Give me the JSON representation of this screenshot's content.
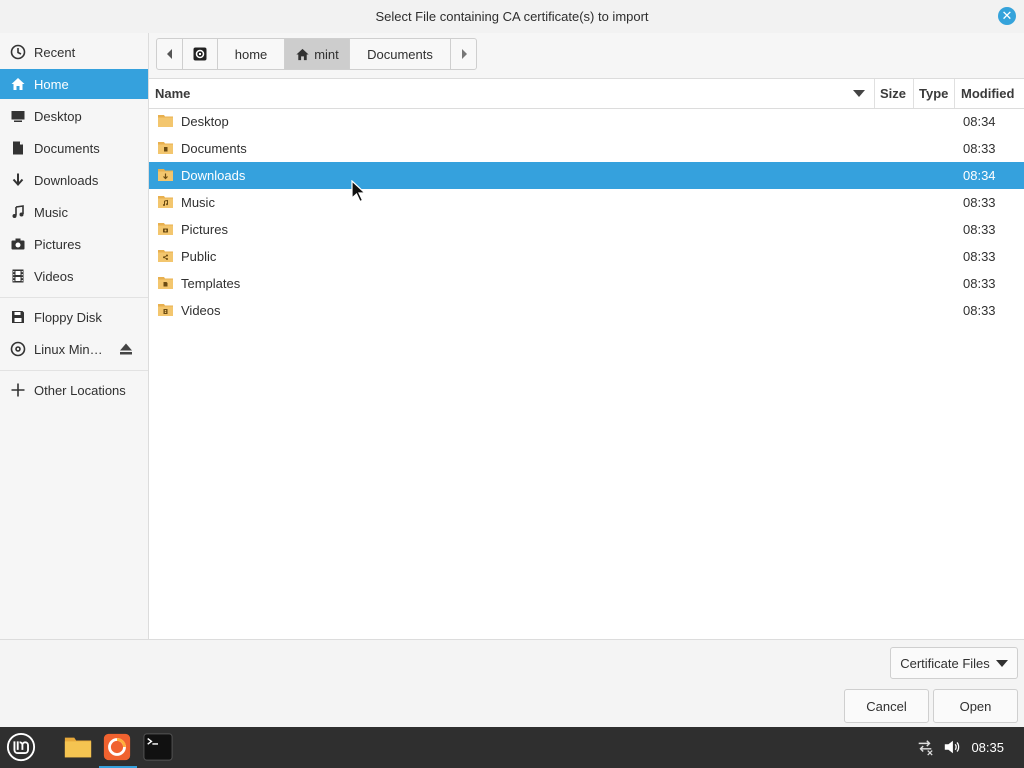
{
  "dialog": {
    "title": "Select File containing CA certificate(s) to import"
  },
  "sidebar": {
    "items": [
      {
        "label": "Recent",
        "icon": "clock-icon"
      },
      {
        "label": "Home",
        "icon": "home-icon"
      },
      {
        "label": "Desktop",
        "icon": "desktop-icon"
      },
      {
        "label": "Documents",
        "icon": "document-icon"
      },
      {
        "label": "Downloads",
        "icon": "download-icon"
      },
      {
        "label": "Music",
        "icon": "music-icon"
      },
      {
        "label": "Pictures",
        "icon": "camera-icon"
      },
      {
        "label": "Videos",
        "icon": "film-icon"
      },
      {
        "label": "Floppy Disk",
        "icon": "floppy-icon"
      },
      {
        "label": "Linux Min…",
        "icon": "disc-icon"
      },
      {
        "label": "Other Locations",
        "icon": "plus-icon"
      }
    ],
    "active": "Home"
  },
  "pathbar": {
    "crumbs": [
      "home",
      "mint",
      "Documents"
    ],
    "active": "mint"
  },
  "filelist": {
    "columns": [
      "Name",
      "Size",
      "Type",
      "Modified"
    ],
    "rows": [
      {
        "name": "Desktop",
        "modified": "08:34"
      },
      {
        "name": "Documents",
        "modified": "08:33"
      },
      {
        "name": "Downloads",
        "modified": "08:34"
      },
      {
        "name": "Music",
        "modified": "08:33"
      },
      {
        "name": "Pictures",
        "modified": "08:33"
      },
      {
        "name": "Public",
        "modified": "08:33"
      },
      {
        "name": "Templates",
        "modified": "08:33"
      },
      {
        "name": "Videos",
        "modified": "08:33"
      }
    ],
    "selected": "Downloads"
  },
  "footer": {
    "filter_label": "Certificate Files",
    "cancel_label": "Cancel",
    "open_label": "Open"
  },
  "taskbar": {
    "apps": [
      "mint-menu-icon",
      "files-icon",
      "firefox-icon",
      "terminal-icon"
    ],
    "clock": "08:35"
  },
  "colors": {
    "accent": "#35a1dd",
    "taskbar": "#2f2f2f",
    "folder": "#f0c36a"
  }
}
